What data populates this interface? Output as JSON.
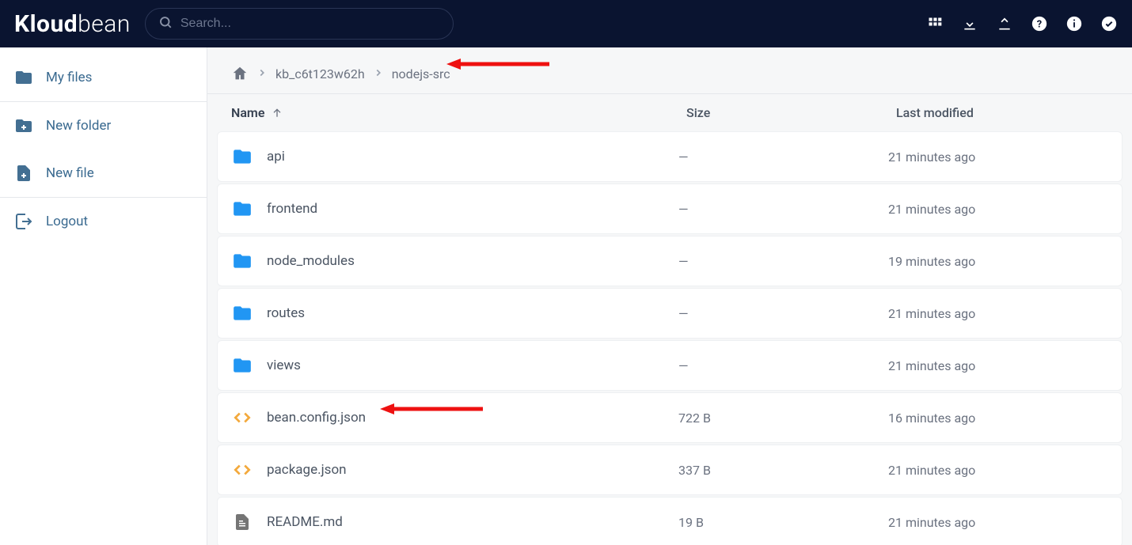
{
  "brand": {
    "part1": "Kloud",
    "part2": "bean"
  },
  "search": {
    "placeholder": "Search..."
  },
  "sidebar": {
    "items": [
      {
        "label": "My files",
        "icon": "folder"
      },
      {
        "label": "New folder",
        "icon": "new-folder"
      },
      {
        "label": "New file",
        "icon": "new-file"
      },
      {
        "label": "Logout",
        "icon": "logout"
      }
    ]
  },
  "breadcrumb": {
    "items": [
      "kb_c6t123w62h",
      "nodejs-src"
    ]
  },
  "columns": {
    "name": "Name",
    "size": "Size",
    "modified": "Last modified"
  },
  "rows": [
    {
      "type": "folder",
      "name": "api",
      "size": "—",
      "modified": "21 minutes ago"
    },
    {
      "type": "folder",
      "name": "frontend",
      "size": "—",
      "modified": "21 minutes ago"
    },
    {
      "type": "folder",
      "name": "node_modules",
      "size": "—",
      "modified": "19 minutes ago"
    },
    {
      "type": "folder",
      "name": "routes",
      "size": "—",
      "modified": "21 minutes ago"
    },
    {
      "type": "folder",
      "name": "views",
      "size": "—",
      "modified": "21 minutes ago"
    },
    {
      "type": "code",
      "name": "bean.config.json",
      "size": "722 B",
      "modified": "16 minutes ago"
    },
    {
      "type": "code",
      "name": "package.json",
      "size": "337 B",
      "modified": "21 minutes ago"
    },
    {
      "type": "doc",
      "name": "README.md",
      "size": "19 B",
      "modified": "21 minutes ago"
    }
  ]
}
